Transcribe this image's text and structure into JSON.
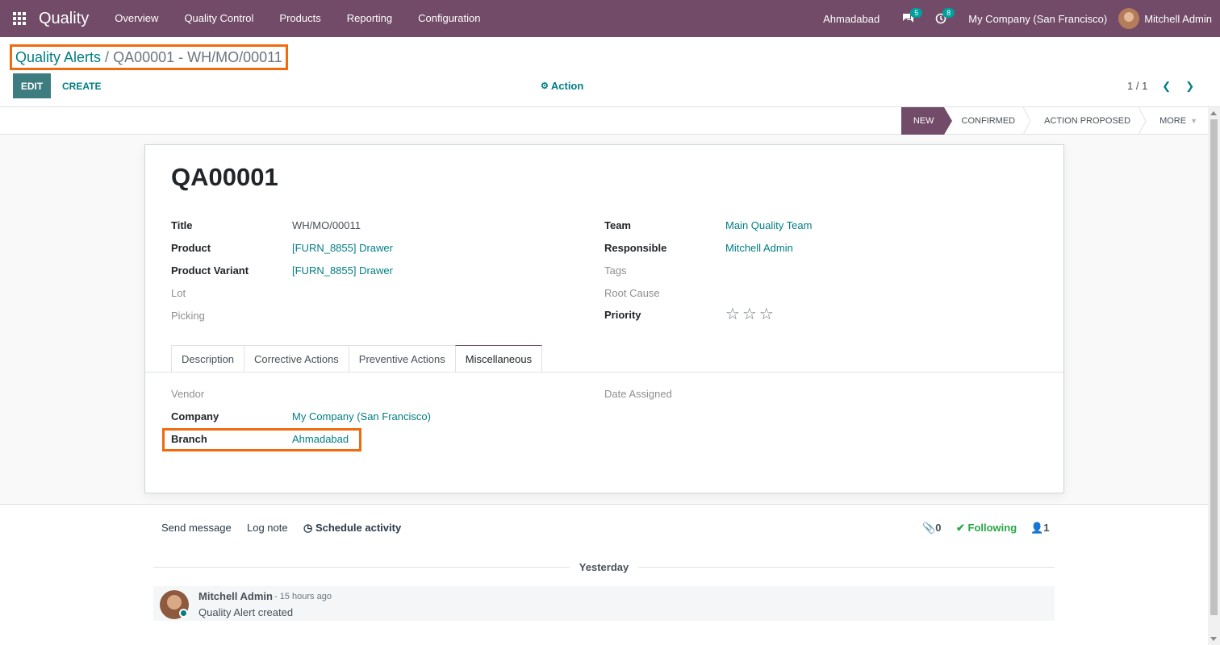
{
  "navbar": {
    "app_name": "Quality",
    "menu": [
      "Overview",
      "Quality Control",
      "Products",
      "Reporting",
      "Configuration"
    ],
    "branch": "Ahmadabad",
    "messages_count": "5",
    "activities_count": "8",
    "company": "My Company (San Francisco)",
    "user": "Mitchell Admin"
  },
  "breadcrumb": {
    "parent": "Quality Alerts",
    "separator": "/",
    "current": "QA00001 - WH/MO/00011"
  },
  "toolbar": {
    "edit_label": "EDIT",
    "create_label": "CREATE",
    "action_label": "Action",
    "pager": "1 / 1"
  },
  "stages": [
    "NEW",
    "CONFIRMED",
    "ACTION PROPOSED",
    "MORE"
  ],
  "record": {
    "name": "QA00001",
    "left_fields": [
      {
        "label": "Title",
        "value": "WH/MO/00011"
      },
      {
        "label": "Product",
        "value": "[FURN_8855] Drawer"
      },
      {
        "label": "Product Variant",
        "value": "[FURN_8855] Drawer"
      },
      {
        "label": "Lot",
        "value": ""
      },
      {
        "label": "Picking",
        "value": ""
      }
    ],
    "right_fields": [
      {
        "label": "Team",
        "value": "Main Quality Team"
      },
      {
        "label": "Responsible",
        "value": "Mitchell Admin"
      },
      {
        "label": "Tags",
        "value": ""
      },
      {
        "label": "Root Cause",
        "value": ""
      },
      {
        "label": "Priority",
        "value": ""
      }
    ],
    "priority_stars": 0,
    "priority_max": 3
  },
  "tabs": [
    "Description",
    "Corrective Actions",
    "Preventive Actions",
    "Miscellaneous"
  ],
  "misc": {
    "vendor_label": "Vendor",
    "vendor_value": "",
    "company_label": "Company",
    "company_value": "My Company (San Francisco)",
    "branch_label": "Branch",
    "branch_value": "Ahmadabad",
    "date_assigned_label": "Date Assigned",
    "date_assigned_value": ""
  },
  "chatter": {
    "send_message": "Send message",
    "log_note": "Log note",
    "schedule_activity": "Schedule activity",
    "attachments": "0",
    "following": "Following",
    "followers": "1",
    "date_separator": "Yesterday",
    "message": {
      "author": "Mitchell Admin",
      "date": "- 15 hours ago",
      "body": "Quality Alert created"
    }
  }
}
